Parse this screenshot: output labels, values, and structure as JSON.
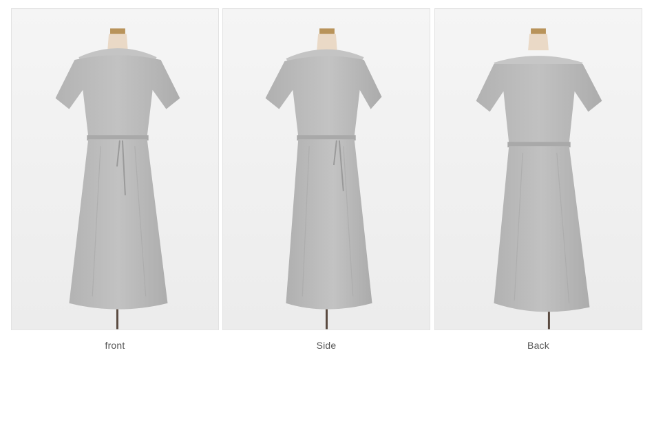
{
  "views": [
    {
      "caption": "front",
      "image": "dress-front-photo"
    },
    {
      "caption": "Side",
      "image": "dress-side-photo"
    },
    {
      "caption": "Back",
      "image": "dress-back-photo"
    }
  ],
  "colors": {
    "background": "#ffffff",
    "panel_bg": "#f3f3f3",
    "dress": "#b9b9b9",
    "dress_shadow": "#a9a9a9",
    "mannequin": "#ead9c6",
    "stand": "#5a4a40",
    "caption_text": "#555555"
  }
}
